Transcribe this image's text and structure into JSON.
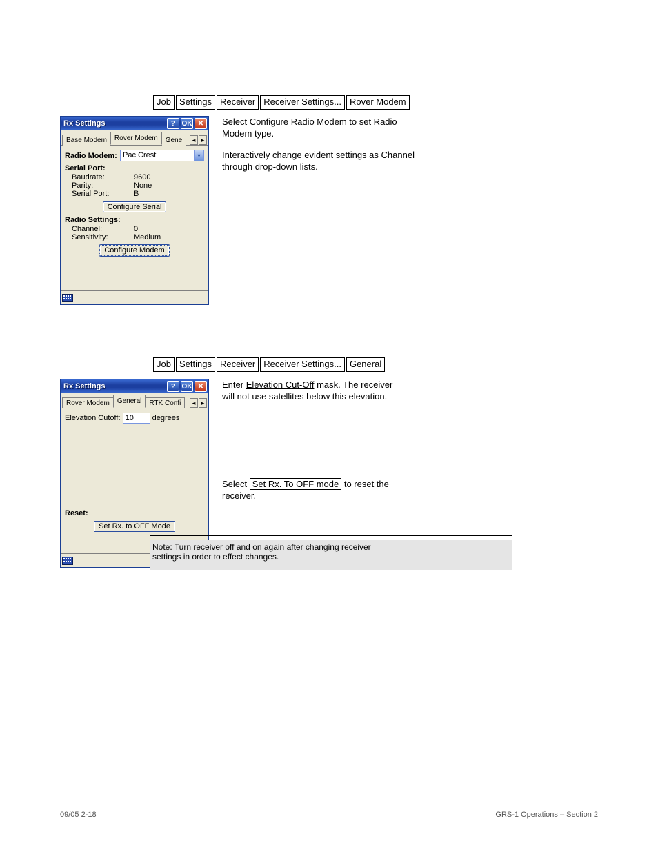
{
  "path1": {
    "items": [
      "Job",
      "Settings",
      "Receiver",
      "Receiver Settings...",
      "Rover Modem"
    ]
  },
  "path2": {
    "items": [
      "Job",
      "Settings",
      "Receiver",
      "Receiver Settings...",
      "General"
    ]
  },
  "dialog1": {
    "title": "Rx Settings",
    "ok": "OK",
    "help": "?",
    "tabs": {
      "left": "Base Modem",
      "active": "Rover Modem",
      "partial": "Gene"
    },
    "radio_modem_label": "Radio Modem:",
    "radio_modem_value": "Pac Crest",
    "serial_port_header": "Serial Port:",
    "baudrate_k": "Baudrate:",
    "baudrate_v": "9600",
    "parity_k": "Parity:",
    "parity_v": "None",
    "serialport_k": "Serial Port:",
    "serialport_v": "B",
    "configure_serial": "Configure Serial",
    "radio_settings_header": "Radio Settings:",
    "channel_k": "Channel:",
    "channel_v": "0",
    "sensitivity_k": "Sensitivity:",
    "sensitivity_v": "Medium",
    "configure_modem": "Configure Modem"
  },
  "narrative1": {
    "line1_pre": "Select ",
    "line1_link": "Configure Radio Modem",
    "line1_post": " to set Radio",
    "line2": "Modem type.",
    "line3_pre": "Interactively change evident settings as ",
    "line3_link": "Channel",
    "line4": "through drop-down lists."
  },
  "dialog2": {
    "title": "Rx Settings",
    "ok": "OK",
    "help": "?",
    "tabs": {
      "left": "Rover Modem",
      "active": "General",
      "right": "RTK Confi"
    },
    "elev_label": "Elevation Cutoff:",
    "elev_value": "10",
    "elev_unit": "degrees",
    "reset_label": "Reset:",
    "set_off": "Set Rx. to OFF Mode"
  },
  "narrative2": {
    "line1_pre": "Enter ",
    "line1_link": "Elevation Cut-Off",
    "line1_post": " mask. The receiver",
    "line2": "will not use satellites below this elevation.",
    "gap": "",
    "line4_pre": "Select ",
    "line4_box": "Set Rx. To OFF mode",
    "line4_post": " to reset the",
    "line5": "receiver."
  },
  "caption": {
    "line1": "Note:  Turn receiver off and on again after changing receiver",
    "line2": "settings in order to effect changes."
  },
  "footer": {
    "left": "09/05 2-18",
    "right": "GRS-1 Operations – Section 2"
  }
}
